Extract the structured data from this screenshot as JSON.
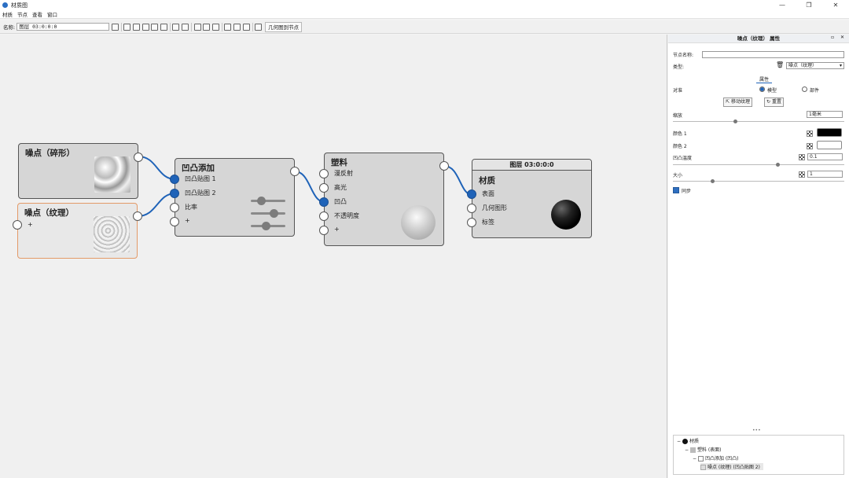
{
  "window": {
    "title": "材质图",
    "min": "—",
    "max": "❐",
    "close": "✕"
  },
  "menu": [
    "材质",
    "节点",
    "查看",
    "窗口"
  ],
  "toolbar": {
    "name_label": "名称:",
    "name_value": "图层 03:0:0:0",
    "graph_button": "几何图到节点"
  },
  "nodes": {
    "noise_fractal": {
      "title": "噪点（碎形）"
    },
    "noise_texture": {
      "title": "噪点（纹理）",
      "port": "+"
    },
    "bump_add": {
      "title": "凹凸添加",
      "ports": [
        "凹凸贴图 1",
        "凹凸贴图 2",
        "比率",
        "+"
      ]
    },
    "plastic": {
      "title": "塑料",
      "ports": [
        "漫反射",
        "高光",
        "凹凸",
        "不透明度",
        "+"
      ]
    },
    "material": {
      "header": "图层 03:0:0:0",
      "title": "材质",
      "ports": [
        "表面",
        "几何图形",
        "标签"
      ]
    }
  },
  "panel": {
    "title": "噪点（纹理） 属性",
    "node_name_label": "节点名称:",
    "node_name_value": "",
    "type_label": "类型:",
    "type_value": "噪点（纹理）",
    "tab": "属性",
    "target_label": "对准",
    "target_model": "模型",
    "target_part": "部件",
    "move_texture": "移动纹理",
    "reset": "重置",
    "scale_label": "缩放",
    "scale_value": "1毫米",
    "color1_label": "颜色 1",
    "color1": "#000000",
    "color2_label": "颜色 2",
    "color2": "#ffffff",
    "bump_depth_label": "凹凸温度",
    "bump_depth_value": "0.1",
    "size_label": "大小",
    "size_value": "1",
    "sync_label": "同步",
    "dots": "•••",
    "tree": [
      "材质",
      "塑料 (表面)",
      "凹凸添加 (凹凸)",
      "噪点 (纹理)   (凹凸贴图 2)"
    ]
  },
  "colors": {
    "accent": "#1f63b8",
    "selected": "#e39a68"
  }
}
